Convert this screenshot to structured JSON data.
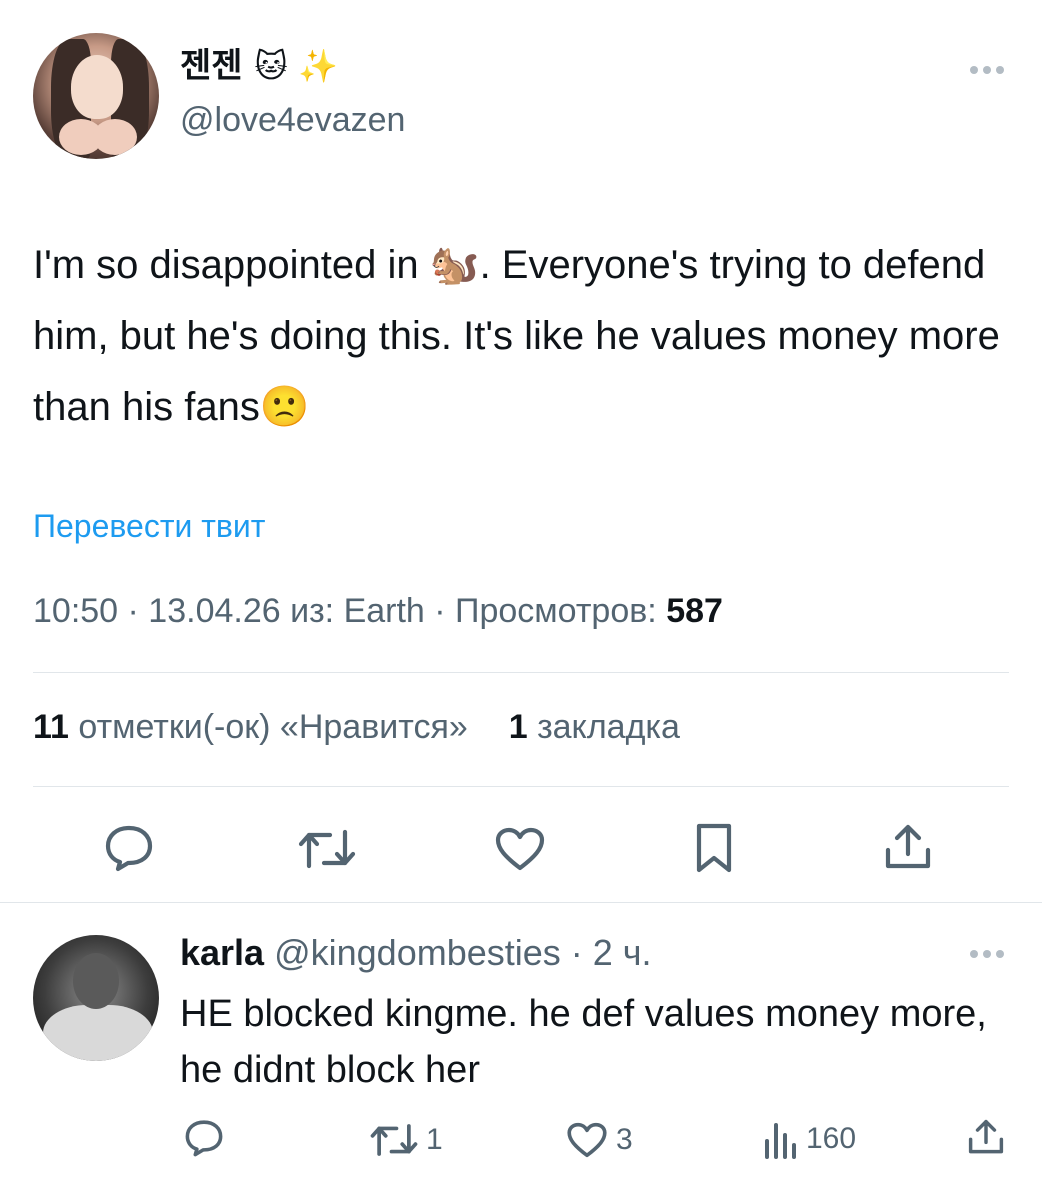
{
  "tweet": {
    "display_name": "젠젠",
    "name_emojis": "🐱 ✨",
    "handle": "@love4evazen",
    "text": "I'm so disappointed in 🐿️. Everyone's trying to defend him, but he's doing this. It's like he values money more than his fans🙁",
    "translate_label": "Перевести твит",
    "meta_prefix": "10:50 · 13.04.26 из: Earth · Просмотров: ",
    "views": "587",
    "likes_count": "11",
    "likes_label": "отметки(-ок) «Нравится»",
    "bookmarks_count": "1",
    "bookmarks_label": "закладка",
    "icons": [
      "reply-icon",
      "retweet-icon",
      "like-icon",
      "bookmark-icon",
      "share-icon"
    ]
  },
  "reply": {
    "name": "karla",
    "handle_time": "@kingdombesties · 2 ч.",
    "text": "HE blocked kingme. he def values money more, he didnt block her",
    "retweets": "1",
    "likes": "3",
    "views": "160",
    "icons": [
      "reply-icon",
      "retweet-icon",
      "like-icon",
      "views-icon",
      "share-icon"
    ]
  },
  "colors": {
    "text": "#0f1419",
    "secondary": "#536471",
    "link": "#1d9bf0",
    "divider": "#e1e6ea"
  }
}
